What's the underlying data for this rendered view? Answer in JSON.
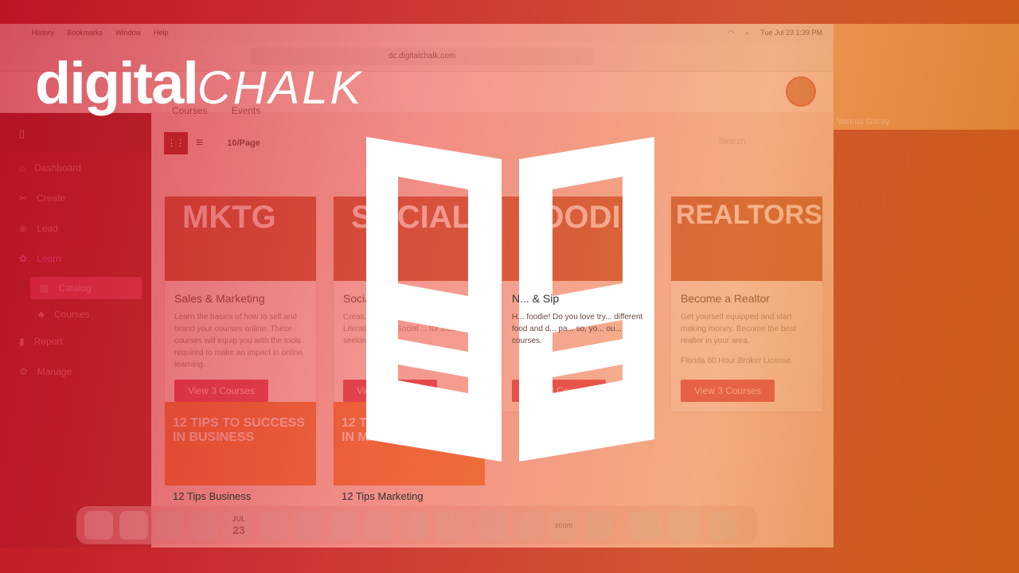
{
  "menubar": {
    "items": [
      "History",
      "Bookmarks",
      "Window",
      "Help"
    ],
    "datetime": "Tue Jul 23  1:39 PM"
  },
  "browser": {
    "url": "dc.digitalchalk.com"
  },
  "app": {
    "tabs": [
      "Courses",
      "Events"
    ],
    "per_page": "10/Page",
    "search_placeholder": "Search"
  },
  "sidebar": {
    "items": [
      {
        "label": "Dashboard",
        "icon": "home-icon"
      },
      {
        "label": "Create",
        "icon": "tools-icon"
      },
      {
        "label": "Lead",
        "icon": "compass-icon"
      },
      {
        "label": "Learn",
        "icon": "brain-icon"
      },
      {
        "label": "Catalog",
        "icon": "catalog-icon",
        "active": true
      },
      {
        "label": "Courses",
        "icon": "courses-icon"
      },
      {
        "label": "Report",
        "icon": "bar-chart-icon"
      },
      {
        "label": "Manage",
        "icon": "gear-icon"
      }
    ]
  },
  "cards": [
    {
      "image_text": "MKTG",
      "title": "Sales & Marketing",
      "desc": "Learn the basics of how to sell and brand your courses online. These courses will equip you with the tools required to make an impact in online learning.",
      "extra": "",
      "button": "View 3 Courses"
    },
    {
      "image_text": "SOCIAL",
      "title": "Social ... ore",
      "desc": "Creati... wanted! Join our Cinem... Literature, and Social ... for those seekin... social...",
      "extra": "",
      "button": "View 3 Courses"
    },
    {
      "image_text": "FOODIE",
      "title": "N... & Sip",
      "desc": "H... foodie! Do you love try... different food and d... pa... so, yo... ou... courses.",
      "extra": "",
      "button": "View 3 Courses"
    },
    {
      "image_text": "REALTORS",
      "title": "Become a Realtor",
      "desc": "Get yourself equipped and start making money. Become the best realtor in your area.",
      "extra": "Florida 60 Hour Broker License",
      "button": "View 3 Courses"
    }
  ],
  "cards_row2": [
    {
      "image_text": "12 TIPS TO SUCCESS IN BUSINESS",
      "title": "12 Tips Business"
    },
    {
      "image_text": "12 TIPS TO SUCCESS IN MARKETING",
      "title": "12 Tips Marketing"
    }
  ],
  "dock": {
    "calendar_month": "JUL",
    "calendar_day": "23",
    "zoom_label": "zoom"
  },
  "webcam": {
    "name": "Varinia Garay"
  },
  "logo": {
    "part1": "digital",
    "part2": "CHALK"
  },
  "colors": {
    "overlay_start": "#c81428",
    "overlay_end": "#d76e14",
    "brand_red": "#8b0d18",
    "button": "#d8325a"
  }
}
